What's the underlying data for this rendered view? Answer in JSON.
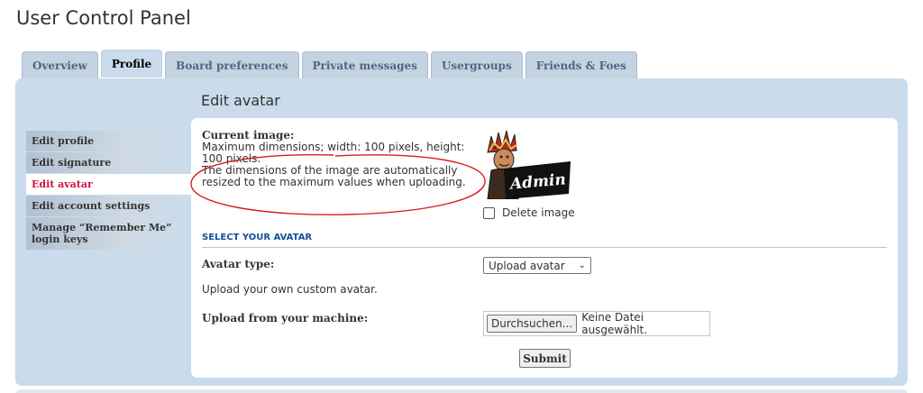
{
  "page": {
    "title": "User Control Panel"
  },
  "tabs": [
    {
      "label": "Overview",
      "active": false
    },
    {
      "label": "Profile",
      "active": true
    },
    {
      "label": "Board preferences",
      "active": false
    },
    {
      "label": "Private messages",
      "active": false
    },
    {
      "label": "Usergroups",
      "active": false
    },
    {
      "label": "Friends & Foes",
      "active": false
    }
  ],
  "panel": {
    "heading": "Edit avatar"
  },
  "menu": [
    {
      "label": "Edit profile",
      "active": false
    },
    {
      "label": "Edit signature",
      "active": false
    },
    {
      "label": "Edit avatar",
      "active": true
    },
    {
      "label": "Edit account settings",
      "active": false
    },
    {
      "label": "Manage “Remember Me” login keys",
      "active": false
    }
  ],
  "current_image": {
    "label": "Current image:",
    "line1": "Maximum dimensions; width: 100 pixels, height: 100 pixels.",
    "line2": "The dimensions of the image are automatically resized to the maximum values when uploading.",
    "avatar_text": "Admin"
  },
  "delete_image": {
    "label": "Delete image",
    "checked": false
  },
  "select_avatar": {
    "section_title": "SELECT YOUR AVATAR"
  },
  "avatar_type": {
    "label": "Avatar type:",
    "selected": "Upload avatar"
  },
  "upload": {
    "description": "Upload your own custom avatar.",
    "machine_label": "Upload from your machine:",
    "browse_label": "Durchsuchen...",
    "no_file_text": "Keine Datei ausgewählt."
  },
  "submit_label": "Submit",
  "colors": {
    "tab_bg": "#c4d3e2",
    "panel_bg": "#cadceb",
    "active_link": "#d31141",
    "section_blue": "#115098",
    "annotation_red": "#d81e1e"
  }
}
